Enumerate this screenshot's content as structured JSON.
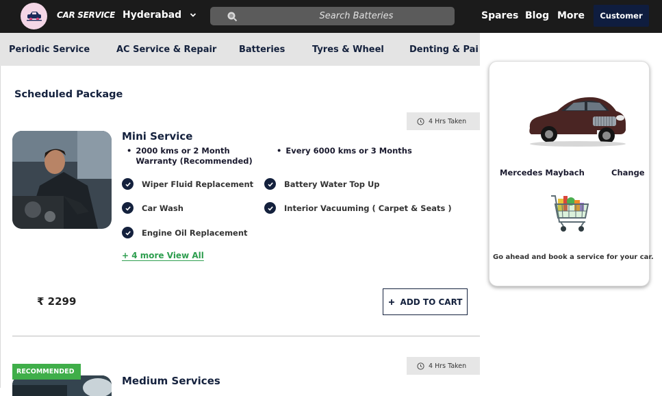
{
  "header": {
    "brand": "CAR SERVICE",
    "city": "Hyderabad",
    "search_placeholder": "Search Batteries",
    "nav": [
      "Spares",
      "Blog",
      "More"
    ],
    "customer_label": "Customer"
  },
  "categories": [
    "Periodic Service",
    "AC Service & Repair",
    "Batteries",
    "Tyres & Wheel",
    "Denting & Pai"
  ],
  "main": {
    "section_title": "Scheduled Package",
    "packages": [
      {
        "hrs_taken": "4 Hrs Taken",
        "title": "Mini Service",
        "warranty": [
          "2000 kms or 2 Month Warranty (Recommended)",
          "Every 6000 kms or 3 Months"
        ],
        "features": [
          "Wiper Fluid Replacement",
          "Battery Water Top Up",
          "Car Wash",
          "Interior Vacuuming ( Carpet & Seats )",
          "Engine Oil Replacement"
        ],
        "view_all": "+ 4 more View All",
        "price": "₹ 2299",
        "add_to_cart": "ADD TO CART"
      },
      {
        "badge": "RECOMMENDED",
        "hrs_taken": "4 Hrs Taken",
        "title": "Medium Services"
      }
    ]
  },
  "sidebar_card": {
    "car_name": "Mercedes Maybach",
    "change_label": "Change",
    "message": "Go ahead and book a service for your car."
  },
  "colors": {
    "header_bg": "#1b1b1b",
    "navy": "#14213d",
    "accent_green": "#3fae49",
    "link_green": "#2e9e4f"
  }
}
